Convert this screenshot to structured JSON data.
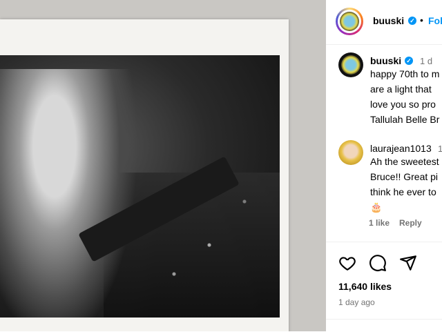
{
  "post": {
    "image_alt": "black and white photo of a man holding a gun and walkie-talkie"
  },
  "header": {
    "username": "buuski",
    "separator": "•",
    "follow_label": "Fol"
  },
  "caption": {
    "username": "buuski",
    "time": "1 d",
    "lines": [
      "happy 70th to m",
      "are a light that",
      "love you so pro",
      "Tallulah Belle Br"
    ]
  },
  "comment": {
    "username": "laurajean1013",
    "time": "1",
    "lines": [
      "Ah the sweetest",
      "Bruce!! Great pi",
      "think he ever to"
    ],
    "emoji": "🎂",
    "likes": "1 like",
    "reply": "Reply"
  },
  "actions": {
    "likes": "11,640 likes",
    "date": "1 day ago"
  },
  "colors": {
    "accent": "#0095f6",
    "meta": "#737373"
  }
}
